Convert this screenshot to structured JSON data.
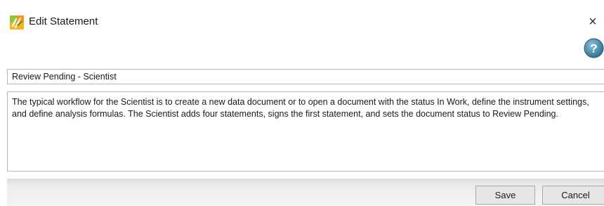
{
  "window": {
    "title": "Edit Statement",
    "close_glyph": "×",
    "help_glyph": "?"
  },
  "icons": {
    "app_logo": "app-logo-icon",
    "close": "close-icon",
    "help": "help-icon"
  },
  "statement": {
    "name": "Review Pending - Scientist",
    "description": "The typical workflow for the Scientist is to create a new data document or to open a document with the status In Work, define the instrument settings, and define analysis formulas. The Scientist adds four statements, signs the first statement, and sets the document status to Review Pending."
  },
  "buttons": {
    "save_label": "Save",
    "cancel_label": "Cancel"
  },
  "colors": {
    "help_icon": "#4a8fb0",
    "logo_green": "#8dc63f",
    "logo_orange": "#f7941d"
  }
}
